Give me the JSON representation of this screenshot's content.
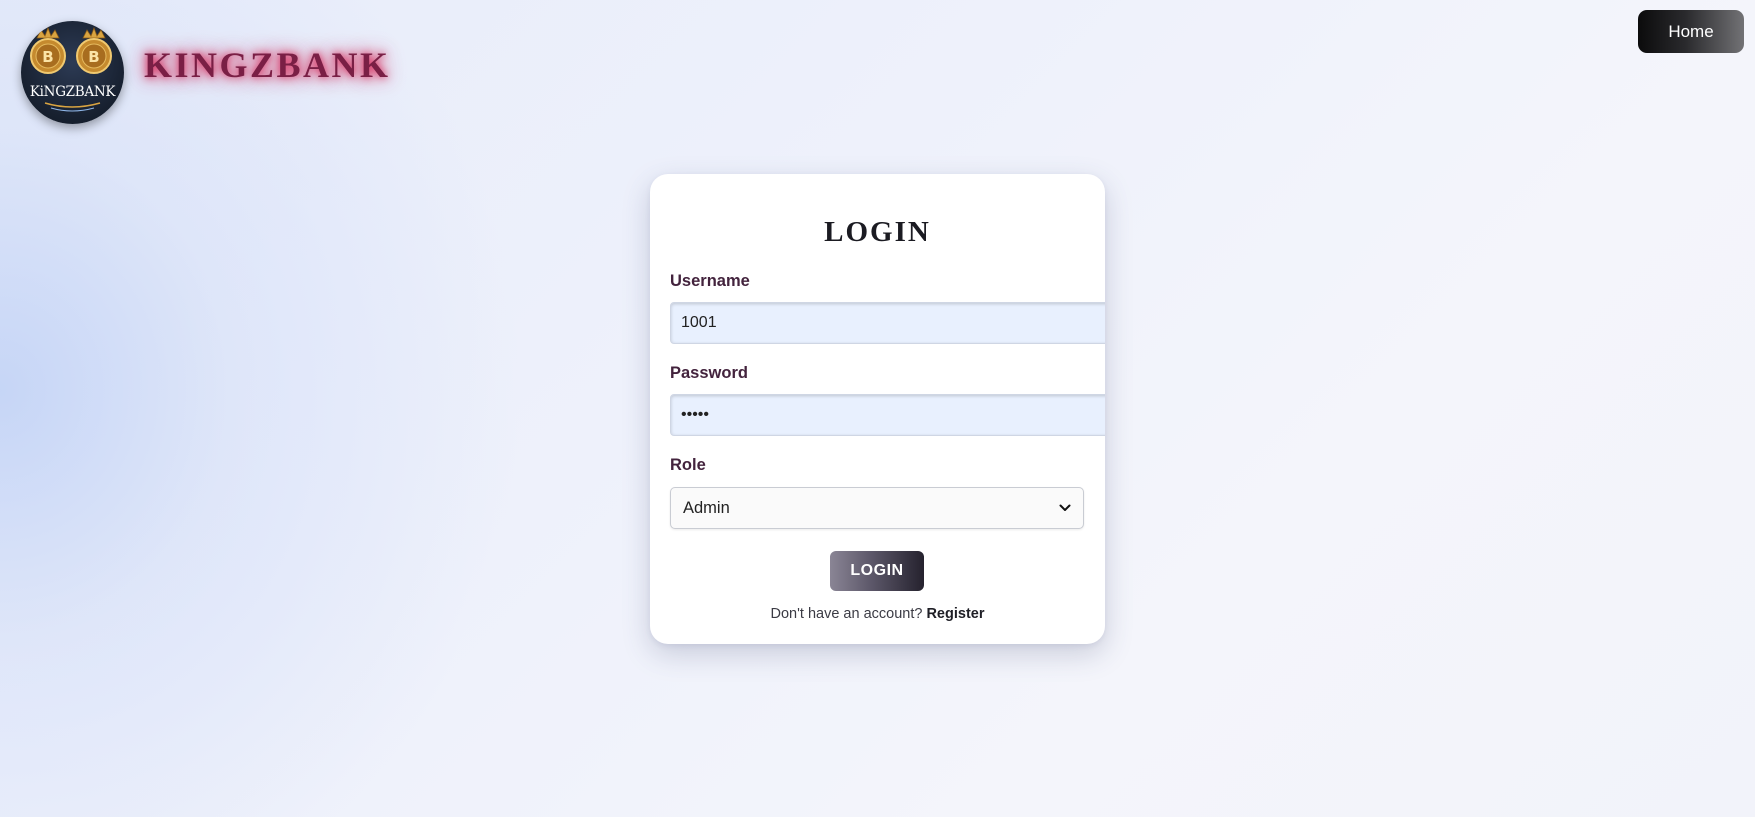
{
  "header": {
    "logo_caption": "KiNGZBANK",
    "brand_title": "KINGZBANK",
    "home_label": "Home",
    "coin_symbol": "B"
  },
  "login": {
    "title": "LOGIN",
    "username_label": "Username",
    "username_value": "1001",
    "password_label": "Password",
    "password_value": "•••••",
    "role_label": "Role",
    "role_value": "Admin",
    "submit_label": "LOGIN",
    "register_prompt": "Don't have an account?",
    "register_link": "Register"
  },
  "colors": {
    "brand_text": "#7a1f45",
    "brand_glow": "#d6285a",
    "label_text": "#43233d",
    "input_bg": "#e8f0fe",
    "home_button_dark": "#0b0b0c",
    "login_button_light": "#8a8595",
    "login_button_dark": "#25222e"
  },
  "icons": {
    "logo": "bitcoin-crown-emblem-icon",
    "role_dropdown": "chevron-down-icon"
  }
}
